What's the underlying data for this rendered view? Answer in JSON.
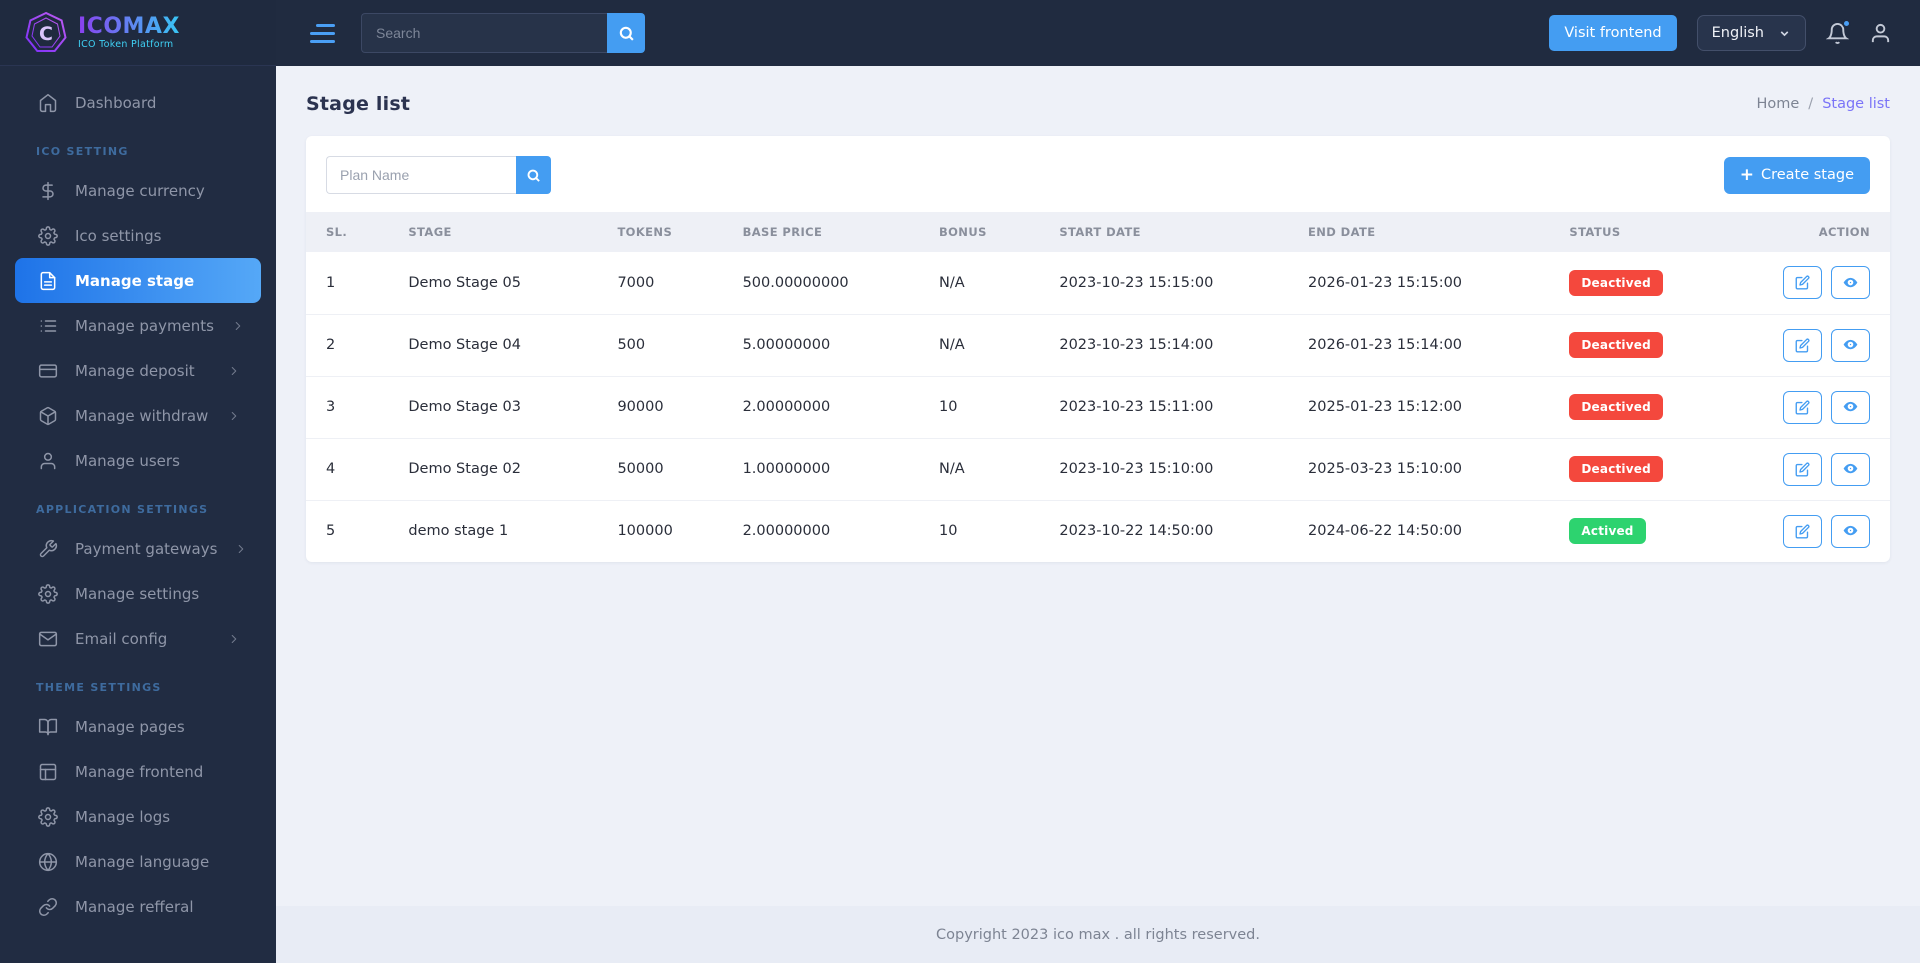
{
  "brand": {
    "name": "ICOMAX",
    "tagline": "ICO Token Platform"
  },
  "topbar": {
    "search_placeholder": "Search",
    "visit_frontend_label": "Visit frontend",
    "language_selected": "English"
  },
  "sidebar": {
    "sections": [
      {
        "heading": "",
        "items": [
          {
            "label": "Dashboard",
            "icon": "home-icon",
            "active": false,
            "chevron": false
          }
        ]
      },
      {
        "heading": "ICO SETTING",
        "items": [
          {
            "label": "Manage currency",
            "icon": "dollar-icon",
            "active": false,
            "chevron": false
          },
          {
            "label": "Ico settings",
            "icon": "gear-icon",
            "active": false,
            "chevron": false
          },
          {
            "label": "Manage stage",
            "icon": "file-icon",
            "active": true,
            "chevron": false
          },
          {
            "label": "Manage payments",
            "icon": "list-icon",
            "active": false,
            "chevron": true
          },
          {
            "label": "Manage deposit",
            "icon": "credit-card-icon",
            "active": false,
            "chevron": true
          },
          {
            "label": "Manage withdraw",
            "icon": "package-icon",
            "active": false,
            "chevron": true
          },
          {
            "label": "Manage users",
            "icon": "user-icon",
            "active": false,
            "chevron": false
          }
        ]
      },
      {
        "heading": "APPLICATION SETTINGS",
        "items": [
          {
            "label": "Payment gateways",
            "icon": "wrench-icon",
            "active": false,
            "chevron": true
          },
          {
            "label": "Manage settings",
            "icon": "gear-icon",
            "active": false,
            "chevron": false
          },
          {
            "label": "Email config",
            "icon": "mail-icon",
            "active": false,
            "chevron": true
          }
        ]
      },
      {
        "heading": "THEME SETTINGS",
        "items": [
          {
            "label": "Manage pages",
            "icon": "book-icon",
            "active": false,
            "chevron": false
          },
          {
            "label": "Manage frontend",
            "icon": "layout-icon",
            "active": false,
            "chevron": false
          },
          {
            "label": "Manage logs",
            "icon": "gear-icon",
            "active": false,
            "chevron": false
          },
          {
            "label": "Manage language",
            "icon": "globe-icon",
            "active": false,
            "chevron": false
          },
          {
            "label": "Manage refferal",
            "icon": "link-icon",
            "active": false,
            "chevron": false
          }
        ]
      }
    ]
  },
  "page": {
    "title": "Stage list",
    "breadcrumb": {
      "home": "Home",
      "separator": "/",
      "current": "Stage list"
    }
  },
  "card": {
    "filter_placeholder": "Plan Name",
    "create_plus": "+",
    "create_label": "Create stage"
  },
  "table": {
    "columns": [
      "SL.",
      "STAGE",
      "TOKENS",
      "BASE PRICE",
      "BONUS",
      "START DATE",
      "END DATE",
      "STATUS",
      "ACTION"
    ],
    "col_widths": [
      "5.2%",
      "13.2%",
      "7.9%",
      "12.4%",
      "7.6%",
      "15.7%",
      "16.5%",
      "12.6%",
      "8.9%"
    ],
    "rows": [
      {
        "sl": "1",
        "stage": "Demo Stage 05",
        "tokens": "7000",
        "base_price": "500.00000000",
        "bonus": "N/A",
        "start_date": "2023-10-23 15:15:00",
        "end_date": "2026-01-23 15:15:00",
        "status": "Deactived",
        "status_type": "danger"
      },
      {
        "sl": "2",
        "stage": "Demo Stage 04",
        "tokens": "500",
        "base_price": "5.00000000",
        "bonus": "N/A",
        "start_date": "2023-10-23 15:14:00",
        "end_date": "2026-01-23 15:14:00",
        "status": "Deactived",
        "status_type": "danger"
      },
      {
        "sl": "3",
        "stage": "Demo Stage 03",
        "tokens": "90000",
        "base_price": "2.00000000",
        "bonus": "10",
        "start_date": "2023-10-23 15:11:00",
        "end_date": "2025-01-23 15:12:00",
        "status": "Deactived",
        "status_type": "danger"
      },
      {
        "sl": "4",
        "stage": "Demo Stage 02",
        "tokens": "50000",
        "base_price": "1.00000000",
        "bonus": "N/A",
        "start_date": "2023-10-23 15:10:00",
        "end_date": "2025-03-23 15:10:00",
        "status": "Deactived",
        "status_type": "danger"
      },
      {
        "sl": "5",
        "stage": "demo stage 1",
        "tokens": "100000",
        "base_price": "2.00000000",
        "bonus": "10",
        "start_date": "2023-10-22 14:50:00",
        "end_date": "2024-06-22 14:50:00",
        "status": "Actived",
        "status_type": "success"
      }
    ]
  },
  "footer": {
    "copyright": "Copyright 2023 ico max . all rights reserved."
  },
  "colors": {
    "accent_blue": "#449df2",
    "active_gradient_start": "#1e73e8",
    "active_gradient_end": "#55a8f7",
    "badge_danger": "#f4483d",
    "badge_success": "#2dd36f",
    "breadcrumb_current": "#7b74f8",
    "sidebar_bg": "#212c42",
    "topbar_bg": "#202b40"
  }
}
